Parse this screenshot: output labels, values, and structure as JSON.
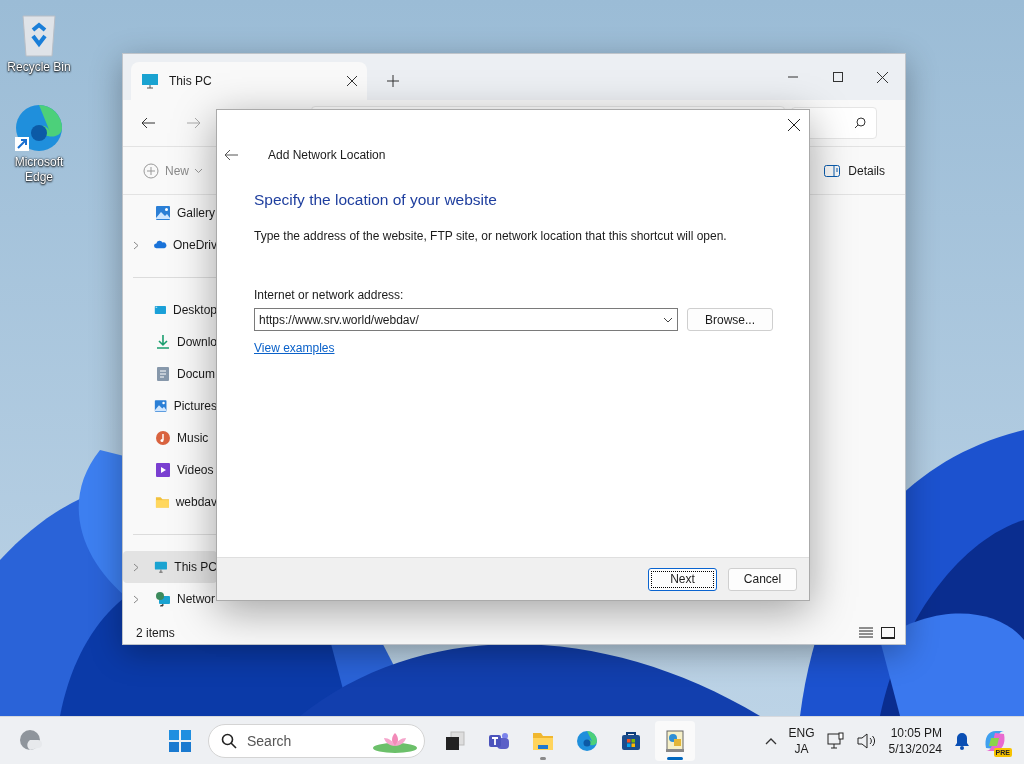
{
  "desktop_icons": [
    {
      "kind": "recycle",
      "label": "Recycle Bin"
    },
    {
      "kind": "edge",
      "label": "Microsoft Edge"
    }
  ],
  "explorer": {
    "tabs": [
      {
        "title": "This PC",
        "selected": true
      }
    ],
    "new_button": "New",
    "details_button": "Details",
    "sidebar": [
      [
        {
          "kind": "gallery",
          "label": "Gallery",
          "expandable": false,
          "selected": false
        },
        {
          "kind": "cloud",
          "label": "OneDriv",
          "expandable": true,
          "selected": false
        }
      ],
      [
        {
          "kind": "desktop",
          "label": "Desktop",
          "expandable": false,
          "selected": false
        },
        {
          "kind": "download",
          "label": "Downlo",
          "expandable": false,
          "selected": false
        },
        {
          "kind": "document",
          "label": "Docum",
          "expandable": false,
          "selected": false
        },
        {
          "kind": "gallery",
          "label": "Pictures",
          "expandable": false,
          "selected": false
        },
        {
          "kind": "music",
          "label": "Music",
          "expandable": false,
          "selected": false
        },
        {
          "kind": "video",
          "label": "Videos",
          "expandable": false,
          "selected": false
        },
        {
          "kind": "folder",
          "label": "webdav",
          "expandable": false,
          "selected": false
        }
      ],
      [
        {
          "kind": "pc",
          "label": "This PC",
          "expandable": true,
          "selected": true
        },
        {
          "kind": "network",
          "label": "Networ",
          "expandable": true,
          "selected": false
        }
      ]
    ],
    "status": "2 items"
  },
  "dialog": {
    "title": "Add Network Location",
    "heading": "Specify the location of your website",
    "description": "Type the address of the website, FTP site, or network location that this shortcut will open.",
    "address_label": "Internet or network address:",
    "address_value": "https://www.srv.world/webdav/",
    "browse_button": "Browse...",
    "link": "View examples",
    "buttons": [
      {
        "label": "Next",
        "default": true
      },
      {
        "label": "Cancel",
        "default": false
      }
    ]
  },
  "taskbar": {
    "search_placeholder": "Search",
    "apps": [
      {
        "kind": "taskview",
        "running": false,
        "selected": false
      },
      {
        "kind": "teams",
        "running": false,
        "selected": false
      },
      {
        "kind": "explorer",
        "running": true,
        "selected": false
      },
      {
        "kind": "edge",
        "running": false,
        "selected": false
      },
      {
        "kind": "store",
        "running": false,
        "selected": false
      },
      {
        "kind": "netapp",
        "running": true,
        "selected": true
      }
    ],
    "language": [
      "ENG",
      "JA"
    ],
    "time": "10:05 PM",
    "date": "5/13/2024",
    "copilot_badge": "PRE"
  }
}
